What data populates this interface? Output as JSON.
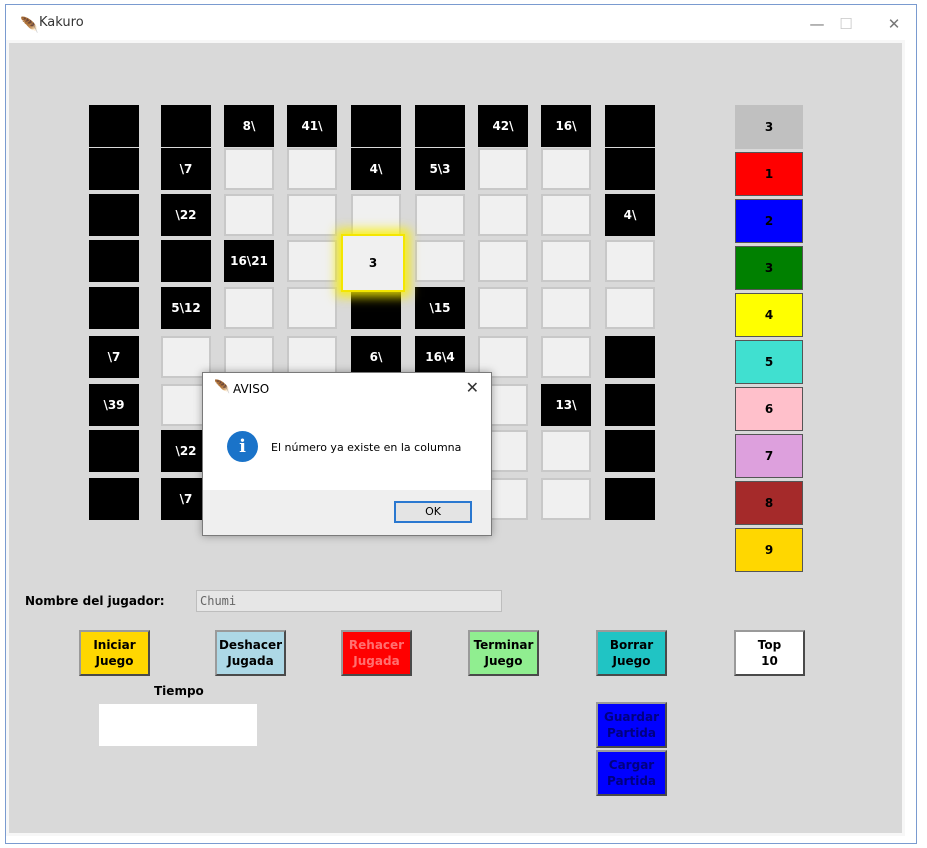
{
  "window": {
    "title": "Kakuro",
    "minimize": "—",
    "maximize": "☐",
    "close": "✕"
  },
  "board_rows": [
    [
      {
        "t": "b",
        "l": ""
      },
      {
        "t": "b",
        "l": ""
      },
      {
        "t": "b",
        "l": "8\\"
      },
      {
        "t": "b",
        "l": "41\\"
      },
      {
        "t": "b",
        "l": ""
      },
      {
        "t": "b",
        "l": ""
      },
      {
        "t": "b",
        "l": "42\\"
      },
      {
        "t": "b",
        "l": "16\\"
      },
      {
        "t": "b",
        "l": ""
      }
    ],
    [
      {
        "t": "b",
        "l": ""
      },
      {
        "t": "b",
        "l": "\\7"
      },
      {
        "t": "w",
        "l": ""
      },
      {
        "t": "w",
        "l": ""
      },
      {
        "t": "b",
        "l": "4\\"
      },
      {
        "t": "b",
        "l": "5\\3"
      },
      {
        "t": "w",
        "l": ""
      },
      {
        "t": "w",
        "l": ""
      },
      {
        "t": "b",
        "l": ""
      }
    ],
    [
      {
        "t": "b",
        "l": ""
      },
      {
        "t": "b",
        "l": "\\22"
      },
      {
        "t": "w",
        "l": ""
      },
      {
        "t": "w",
        "l": ""
      },
      {
        "t": "w",
        "l": ""
      },
      {
        "t": "w",
        "l": ""
      },
      {
        "t": "w",
        "l": ""
      },
      {
        "t": "w",
        "l": ""
      },
      {
        "t": "b",
        "l": "4\\"
      }
    ],
    [
      {
        "t": "b",
        "l": ""
      },
      {
        "t": "b",
        "l": ""
      },
      {
        "t": "b",
        "l": "16\\21"
      },
      {
        "t": "w",
        "l": ""
      },
      {
        "t": "h",
        "l": "3"
      },
      {
        "t": "w",
        "l": ""
      },
      {
        "t": "w",
        "l": ""
      },
      {
        "t": "w",
        "l": ""
      },
      {
        "t": "w",
        "l": ""
      }
    ],
    [
      {
        "t": "b",
        "l": ""
      },
      {
        "t": "b",
        "l": "5\\12"
      },
      {
        "t": "w",
        "l": ""
      },
      {
        "t": "w",
        "l": ""
      },
      {
        "t": "b",
        "l": ""
      },
      {
        "t": "b",
        "l": "\\15"
      },
      {
        "t": "w",
        "l": ""
      },
      {
        "t": "w",
        "l": ""
      },
      {
        "t": "w",
        "l": ""
      }
    ],
    [
      {
        "t": "b",
        "l": "\\7"
      },
      {
        "t": "w",
        "l": ""
      },
      {
        "t": "w",
        "l": ""
      },
      {
        "t": "w",
        "l": ""
      },
      {
        "t": "b",
        "l": "6\\"
      },
      {
        "t": "b",
        "l": "16\\4"
      },
      {
        "t": "w",
        "l": ""
      },
      {
        "t": "w",
        "l": ""
      },
      {
        "t": "b",
        "l": ""
      }
    ],
    [
      {
        "t": "b",
        "l": "\\39"
      },
      {
        "t": "w",
        "l": ""
      },
      {
        "t": "w",
        "l": ""
      },
      {
        "t": "w",
        "l": ""
      },
      {
        "t": "w",
        "l": ""
      },
      {
        "t": "w",
        "l": ""
      },
      {
        "t": "w",
        "l": ""
      },
      {
        "t": "b",
        "l": "13\\"
      },
      {
        "t": "b",
        "l": ""
      }
    ],
    [
      {
        "t": "b",
        "l": ""
      },
      {
        "t": "b",
        "l": "\\22"
      },
      {
        "t": "w",
        "l": ""
      },
      {
        "t": "w",
        "l": ""
      },
      {
        "t": "w",
        "l": ""
      },
      {
        "t": "w",
        "l": ""
      },
      {
        "t": "w",
        "l": ""
      },
      {
        "t": "w",
        "l": ""
      },
      {
        "t": "b",
        "l": ""
      }
    ],
    [
      {
        "t": "b",
        "l": ""
      },
      {
        "t": "b",
        "l": "\\7"
      },
      {
        "t": "w",
        "l": ""
      },
      {
        "t": "w",
        "l": ""
      },
      {
        "t": "w",
        "l": ""
      },
      {
        "t": "w",
        "l": ""
      },
      {
        "t": "w",
        "l": ""
      },
      {
        "t": "w",
        "l": ""
      },
      {
        "t": "b",
        "l": ""
      }
    ]
  ],
  "palette": [
    {
      "label": "3",
      "color": "#c0c0c0"
    },
    {
      "label": "1",
      "color": "#ff0000"
    },
    {
      "label": "2",
      "color": "#0000ff"
    },
    {
      "label": "3",
      "color": "#008000"
    },
    {
      "label": "4",
      "color": "#ffff00"
    },
    {
      "label": "5",
      "color": "#40e0d0"
    },
    {
      "label": "6",
      "color": "#ffc0cb"
    },
    {
      "label": "7",
      "color": "#dda0dd"
    },
    {
      "label": "8",
      "color": "#a52a2a"
    },
    {
      "label": "9",
      "color": "#ffd700"
    }
  ],
  "player": {
    "label": "Nombre del jugador:",
    "value": "Chumi"
  },
  "buttons": {
    "iniciar": {
      "label": "Iniciar\nJuego",
      "color": "#ffd700",
      "text_color": "#000000"
    },
    "deshacer": {
      "label": "Deshacer\nJugada",
      "color": "#add8e6",
      "text_color": "#000000"
    },
    "rehacer": {
      "label": "Rehacer\nJugada",
      "color": "#ff0000",
      "text_color": "#ff7070"
    },
    "terminar": {
      "label": "Terminar\nJuego",
      "color": "#90ee90",
      "text_color": "#000000"
    },
    "borrar": {
      "label": "Borrar\nJuego",
      "color": "#20c4c4",
      "text_color": "#000000"
    },
    "top": {
      "label": "Top\n10",
      "color": "#ffffff",
      "text_color": "#000000"
    },
    "guardar": {
      "label": "Guardar\nPartida",
      "color": "#0000ff",
      "text_color": "#000080"
    },
    "cargar": {
      "label": "Cargar\nPartida",
      "color": "#0000ff",
      "text_color": "#000080"
    }
  },
  "tiempo": {
    "label": "Tiempo",
    "value": ""
  },
  "dialog": {
    "title": "AVISO",
    "message": "El número ya existe en la columna",
    "ok": "OK",
    "close": "✕",
    "icon": "i"
  }
}
